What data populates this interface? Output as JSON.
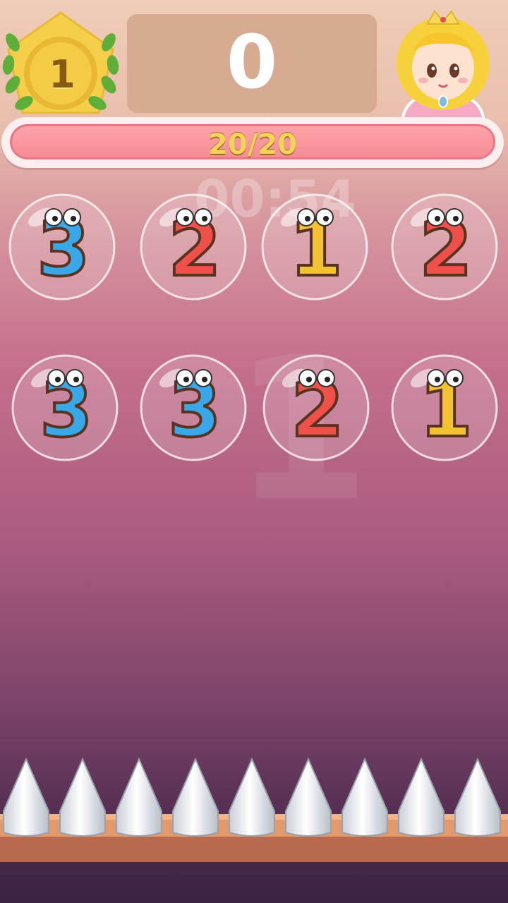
{
  "hud": {
    "level": "1",
    "score": "0",
    "progress_text": "20/20",
    "progress_fraction": 1.0,
    "timer": "00:54"
  },
  "board": {
    "ghost_number": "1",
    "bubbles": [
      {
        "digit": "3",
        "color": "blue",
        "icon": "number-3-character-icon"
      },
      {
        "digit": "2",
        "color": "red",
        "icon": "number-2-character-icon"
      },
      {
        "digit": "1",
        "color": "yellow",
        "icon": "number-1-character-icon"
      },
      {
        "digit": "2",
        "color": "red",
        "icon": "number-2-character-icon"
      },
      {
        "digit": "3",
        "color": "blue",
        "icon": "number-3-character-icon"
      },
      {
        "digit": "3",
        "color": "blue",
        "icon": "number-3-character-icon"
      },
      {
        "digit": "2",
        "color": "red",
        "icon": "number-2-character-icon"
      },
      {
        "digit": "1",
        "color": "yellow",
        "icon": "number-1-character-icon"
      }
    ]
  },
  "colors": {
    "blue": "#3aa8e8",
    "red": "#f0504a",
    "yellow": "#f2c230",
    "bar_fill": "#f58c95",
    "bar_text": "#f4d35a"
  },
  "icons": {
    "level_badge": "laurel-pentagon-badge-icon",
    "avatar": "princess-avatar",
    "hazard": "spike-row"
  }
}
